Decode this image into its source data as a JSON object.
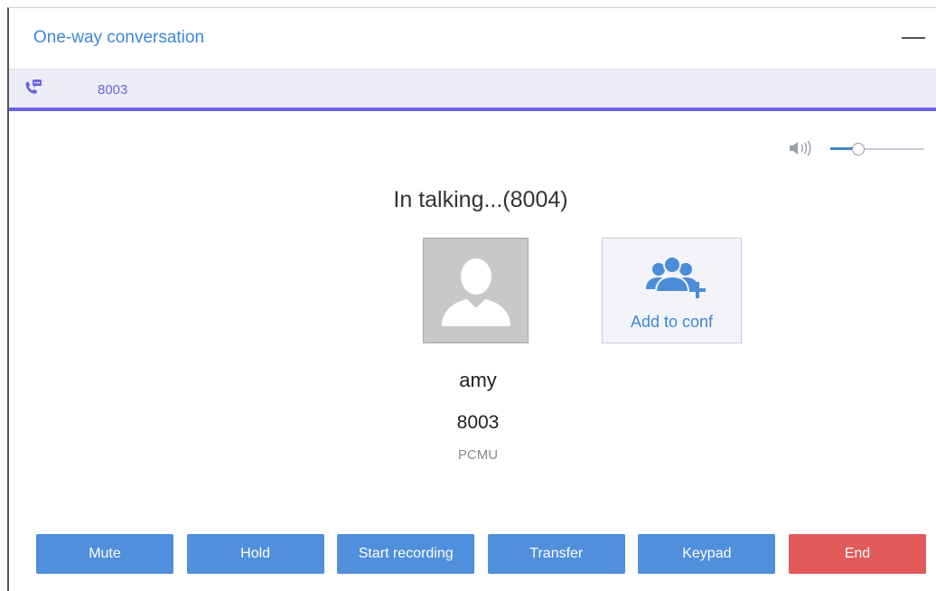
{
  "window": {
    "title": "One-way conversation"
  },
  "tab": {
    "label": "8003",
    "icon": "phone-chat-icon"
  },
  "volume": {
    "level": 0.3,
    "icon": "speaker-icon"
  },
  "call": {
    "status": "In talking...(8004)",
    "caller_name": "amy",
    "caller_number": "8003",
    "codec": "PCMU"
  },
  "conference": {
    "label": "Add to conf",
    "icon": "add-group-icon"
  },
  "actions": {
    "mute": "Mute",
    "hold": "Hold",
    "record": "Start recording",
    "transfer": "Transfer",
    "keypad": "Keypad",
    "end": "End"
  },
  "colors": {
    "accent_blue": "#3f87d4",
    "tab_purple": "#6b63e0",
    "button_blue": "#4f8fdc",
    "end_red": "#e05a5a"
  }
}
